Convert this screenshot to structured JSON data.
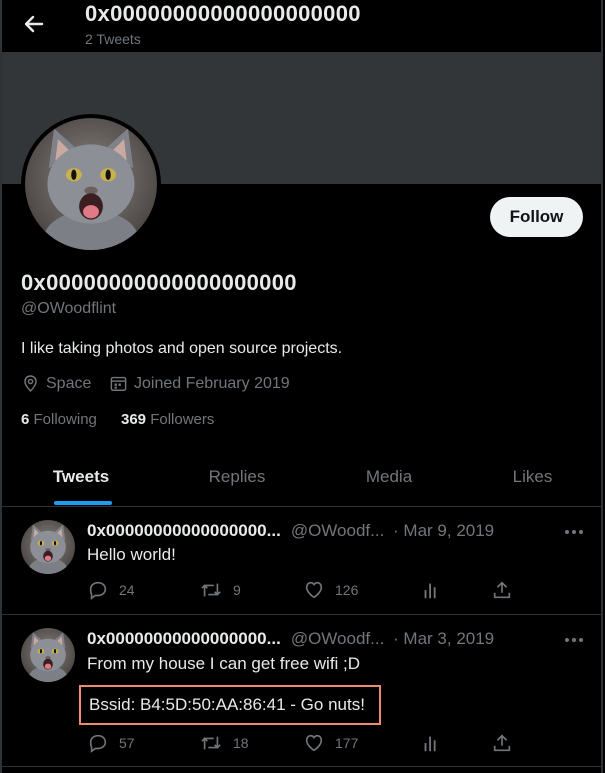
{
  "header": {
    "title": "0x00000000000000000000",
    "subtitle": "2 Tweets"
  },
  "profile": {
    "name": "0x00000000000000000000",
    "handle": "@OWoodflint",
    "bio": "I like taking photos and open source projects.",
    "location": "Space",
    "joined": "Joined February 2019",
    "following_count": "6",
    "following_label": "Following",
    "followers_count": "369",
    "followers_label": "Followers",
    "follow_label": "Follow"
  },
  "tabs": [
    {
      "label": "Tweets",
      "active": true
    },
    {
      "label": "Replies"
    },
    {
      "label": "Media"
    },
    {
      "label": "Likes"
    }
  ],
  "tweets": [
    {
      "name": "0x00000000000000000...",
      "handle": "@OWoodf...",
      "date": "· Mar 9, 2019",
      "text": "Hello world!",
      "replies": "24",
      "retweets": "9",
      "likes": "126"
    },
    {
      "name": "0x00000000000000000...",
      "handle": "@OWoodf...",
      "date": "· Mar 3, 2019",
      "text": "From my house I can get free wifi ;D",
      "highlight": "Bssid: B4:5D:50:AA:86:41 - Go nuts!",
      "replies": "57",
      "retweets": "18",
      "likes": "177"
    }
  ],
  "colors": {
    "accent": "#1d9bf0",
    "highlight_border": "#f08a6e",
    "banner": "#333639"
  },
  "icons": [
    "back-arrow-icon",
    "location-icon",
    "calendar-icon",
    "more-icon",
    "reply-icon",
    "retweet-icon",
    "like-icon",
    "views-icon",
    "share-icon"
  ]
}
